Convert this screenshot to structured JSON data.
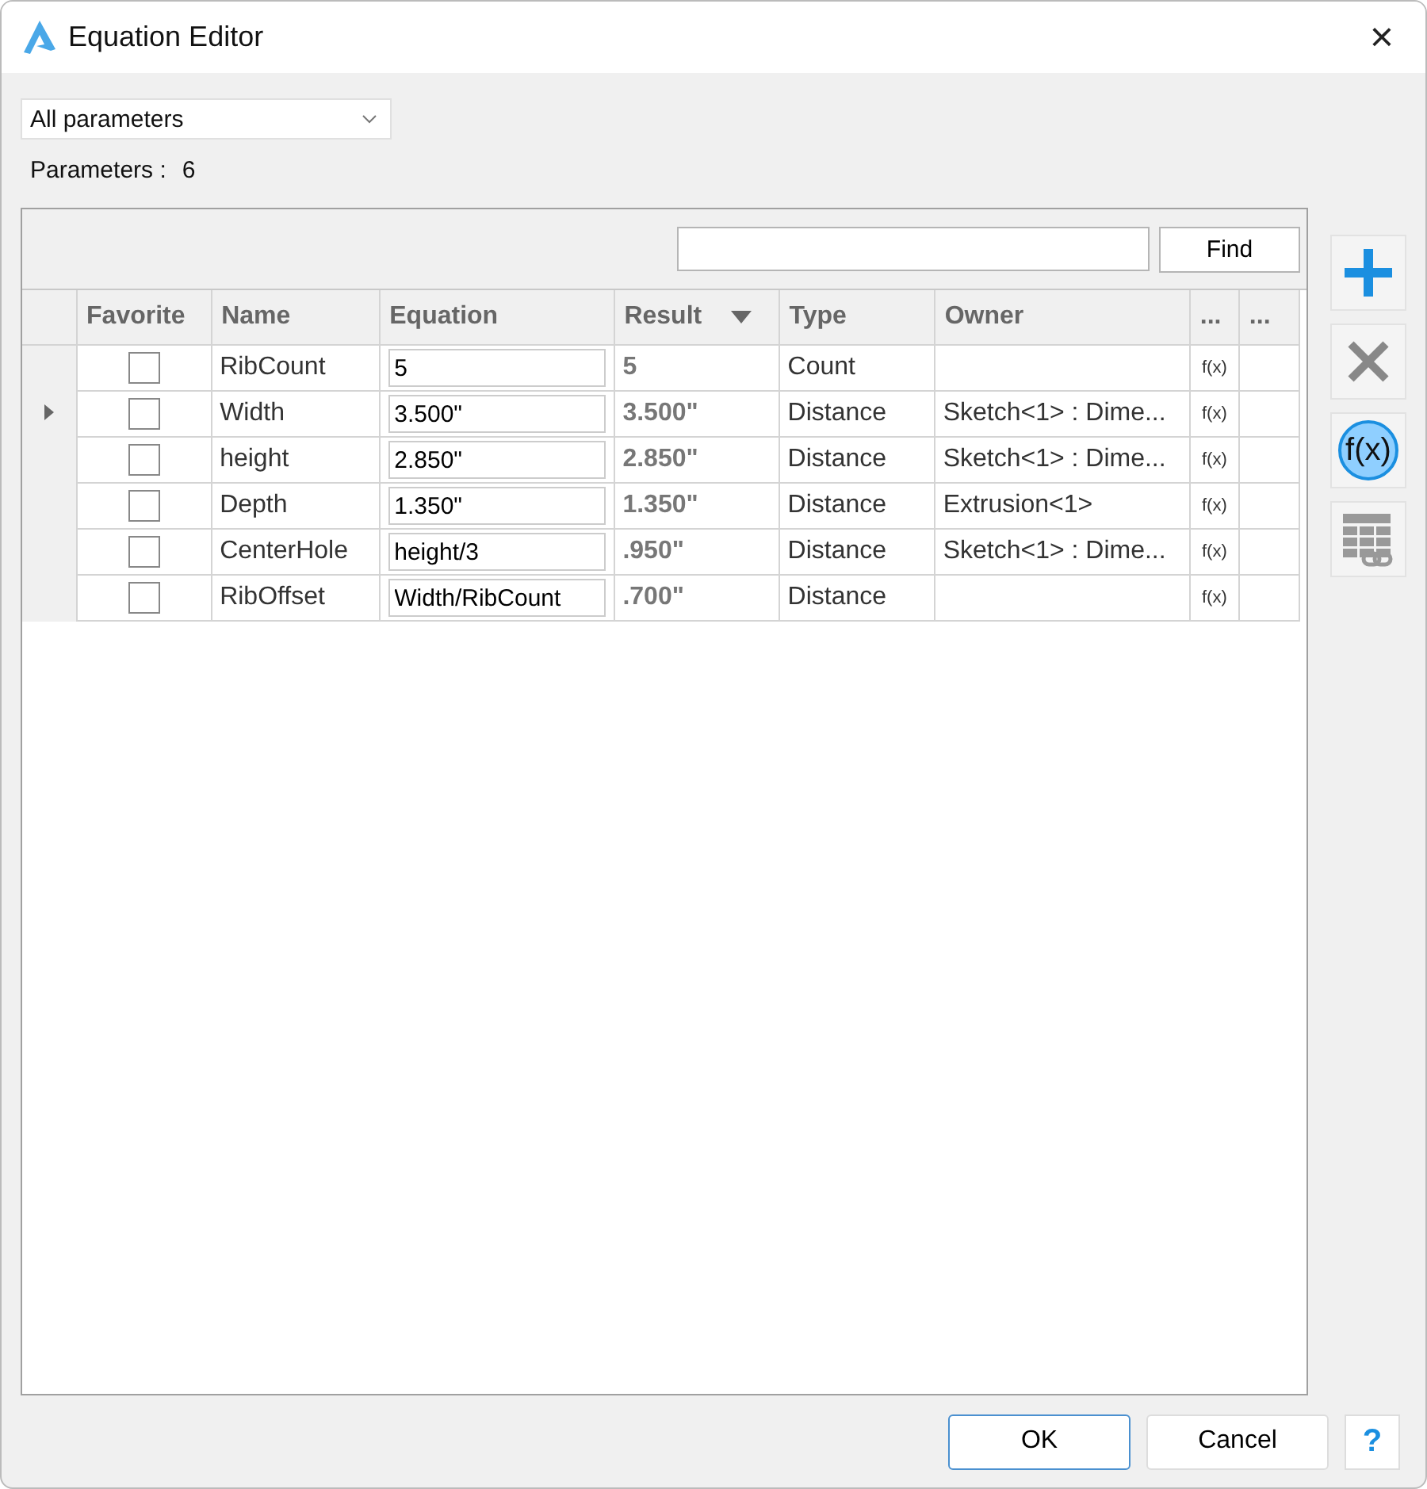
{
  "window": {
    "title": "Equation Editor",
    "close": "×"
  },
  "filter": {
    "value": "All parameters"
  },
  "count": {
    "label": "Parameters :",
    "value": "6"
  },
  "search": {
    "button": "Find"
  },
  "table": {
    "columns": [
      {},
      {
        "label": "Favorite"
      },
      {
        "label": "Name"
      },
      {
        "label": "Equation"
      },
      {
        "label": "Result",
        "sorted": true
      },
      {
        "label": "Type"
      },
      {
        "label": "Owner"
      },
      {
        "label": "..."
      },
      {
        "label": "..."
      }
    ],
    "rows": [
      {
        "current": false,
        "favorite": false,
        "name": "RibCount",
        "equation": "5",
        "result": "5",
        "type": "Count",
        "fx": "f(x)"
      },
      {
        "current": true,
        "favorite": false,
        "name": "Width",
        "equation": "3.500\"",
        "result": "3.500\"",
        "type": "Distance",
        "owner": "Sketch<1> : Dime...",
        "fx": "f(x)"
      },
      {
        "current": false,
        "favorite": false,
        "name": "height",
        "equation": "2.850\"",
        "result": "2.850\"",
        "type": "Distance",
        "owner": "Sketch<1> : Dime...",
        "fx": "f(x)"
      },
      {
        "current": false,
        "favorite": false,
        "name": "Depth",
        "equation": "1.350\"",
        "result": "1.350\"",
        "type": "Distance",
        "owner": "Extrusion<1>",
        "fx": "f(x)"
      },
      {
        "current": false,
        "favorite": false,
        "name": "CenterHole",
        "equation": "height/3",
        "result": ".950\"",
        "type": "Distance",
        "owner": "Sketch<1> : Dime...",
        "fx": "f(x)"
      },
      {
        "current": false,
        "favorite": false,
        "name": "RibOffset",
        "equation": "Width/RibCount",
        "result": ".700\"",
        "type": "Distance",
        "fx": "f(x)"
      }
    ]
  },
  "side_tools": [
    {
      "kind": "add"
    },
    {
      "kind": "delete"
    },
    {
      "kind": "function",
      "label": "f(x)"
    },
    {
      "kind": "link-table"
    }
  ],
  "buttons": [
    {
      "label": "OK",
      "default": true
    },
    {
      "label": "Cancel",
      "default": false
    }
  ],
  "help": "?"
}
